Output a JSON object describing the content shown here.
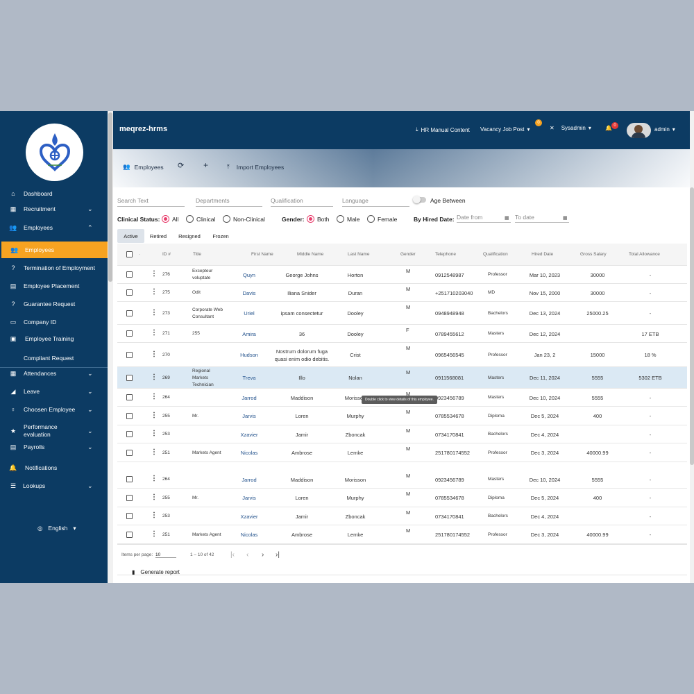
{
  "app": {
    "title": "meqrez-hrms"
  },
  "topbar": {
    "hr_manual": "HR Manual Content",
    "vacancy": "Vacancy Job Post",
    "vacancy_badge": "0",
    "sysadmin": "Sysadmin",
    "notif_badge": "0",
    "user": "admin"
  },
  "banner": {
    "employees": "Employees",
    "refresh": "⟳",
    "add": "+",
    "import": "Import Employees"
  },
  "sidebar": {
    "items": [
      {
        "label": "Dashboard",
        "icon": "⌂"
      },
      {
        "label": "Recruitment",
        "icon": "▦"
      },
      {
        "label": "Employees",
        "icon": "👥"
      },
      {
        "label": "Employees",
        "icon": "👥"
      },
      {
        "label": "Termination of Employment",
        "icon": "?"
      },
      {
        "label": "Employee Placement",
        "icon": "▤"
      },
      {
        "label": "Guarantee Request",
        "icon": "?"
      },
      {
        "label": "Company ID",
        "icon": "▭"
      },
      {
        "label": "Employee Training",
        "icon": "▣"
      },
      {
        "label": "Compliant Request",
        "icon": ""
      },
      {
        "label": "Attendances",
        "icon": "▦"
      },
      {
        "label": "Leave",
        "icon": "◢"
      },
      {
        "label": "Choosen Employee",
        "icon": "♀"
      },
      {
        "label": "Performance evaluation",
        "icon": "★"
      },
      {
        "label": "Payrolls",
        "icon": "▤"
      },
      {
        "label": "Notifications",
        "icon": "🔔"
      },
      {
        "label": "Lookups",
        "icon": "☰"
      }
    ],
    "language": "English",
    "language_caret": "▾"
  },
  "filters": {
    "search_text": "Search Text",
    "departments": "Departments",
    "qualification": "Qualification",
    "language": "Language",
    "age_between": "Age Between",
    "clinical_status_label": "Clinical Status:",
    "clinical_options": [
      "All",
      "Clinical",
      "Non-Clinical"
    ],
    "gender_label": "Gender:",
    "gender_options": [
      "Both",
      "Male",
      "Female"
    ],
    "hired_label": "By Hired Date:",
    "date_from": "Date from",
    "to_date": "To date"
  },
  "tabs": [
    "Active",
    "Retired",
    "Resigned",
    "Frozen"
  ],
  "table": {
    "headers": [
      "ID #",
      "Title",
      "First Name",
      "Middle Name",
      "Last Name",
      "Gender",
      "Telephone",
      "Qualification",
      "Hired Date",
      "Gross Salary",
      "Total Allowance"
    ],
    "sort_dot": "·",
    "rows": [
      {
        "id": "276",
        "title": "Excepteur voluptate",
        "first": "Quyn",
        "middle": "George Johns",
        "last": "Horton",
        "gender": "M",
        "tel": "0912548987",
        "qual": "Professor",
        "hired": "Mar 10, 2023",
        "salary": "30000",
        "allow": "-"
      },
      {
        "id": "275",
        "title": "Odit",
        "first": "Davis",
        "middle": "Iliana Snider",
        "last": "Duran",
        "gender": "M",
        "tel": "+251710203040",
        "qual": "MD",
        "hired": "Nov 15, 2000",
        "salary": "30000",
        "allow": "-"
      },
      {
        "id": "273",
        "title": "Corporate Web Consultant",
        "first": "Uriel",
        "middle": "ipsam consectetur",
        "last": "Dooley",
        "gender": "M",
        "tel": "0948948948",
        "qual": "Bachelors",
        "hired": "Dec 13, 2024",
        "salary": "25000.25",
        "allow": "-"
      },
      {
        "id": "271",
        "title": "255",
        "first": "Amira",
        "middle": "36",
        "last": "Dooley",
        "gender": "F",
        "tel": "0789455612",
        "qual": "Masters",
        "hired": "Dec 12, 2024",
        "salary": "",
        "allow": "17 ETB"
      },
      {
        "id": "270",
        "title": "",
        "first": "Hudson",
        "middle": "Nostrum dolorum fuga quasi enim odio debitis.",
        "last": "Crist",
        "gender": "M",
        "tel": "0965456545",
        "qual": "Professor",
        "hired": "Jan 23, 2",
        "salary": "15000",
        "allow": "18 %"
      },
      {
        "id": "269",
        "title": "Regional Markets Technician",
        "first": "Treva",
        "middle": "Illo",
        "last": "Nolan",
        "gender": "M",
        "tel": "0911568081",
        "qual": "Masters",
        "hired": "Dec 11, 2024",
        "salary": "5555",
        "allow": "5302 ETB"
      },
      {
        "id": "264",
        "title": "",
        "first": "Jarrod",
        "middle": "Maddison",
        "last": "Morisson",
        "gender": "M",
        "tel": "0923456789",
        "qual": "Masters",
        "hired": "Dec 10, 2024",
        "salary": "5555",
        "allow": "-"
      },
      {
        "id": "255",
        "title": "Mr.",
        "first": "Jarvis",
        "middle": "Loren",
        "last": "Murphy",
        "gender": "M",
        "tel": "0785534678",
        "qual": "Diploma",
        "hired": "Dec 5, 2024",
        "salary": "400",
        "allow": "-"
      },
      {
        "id": "253",
        "title": "",
        "first": "Xzavier",
        "middle": "Jamir",
        "last": "Zboncak",
        "gender": "M",
        "tel": "0734170841",
        "qual": "Bachelors",
        "hired": "Dec 4, 2024",
        "salary": "",
        "allow": "-"
      },
      {
        "id": "251",
        "title": "Markets Agent",
        "first": "Nicolas",
        "middle": "Ambrose",
        "last": "Lemke",
        "gender": "M",
        "tel": "251780174552",
        "qual": "Professor",
        "hired": "Dec 3, 2024",
        "salary": "40000.99",
        "allow": "-"
      },
      {
        "id": "264",
        "title": "",
        "first": "Jarrod",
        "middle": "Maddison",
        "last": "Morisson",
        "gender": "M",
        "tel": "0923456789",
        "qual": "Masters",
        "hired": "Dec 10, 2024",
        "salary": "5555",
        "allow": "-"
      },
      {
        "id": "255",
        "title": "Mr.",
        "first": "Jarvis",
        "middle": "Loren",
        "last": "Murphy",
        "gender": "M",
        "tel": "0785534678",
        "qual": "Diploma",
        "hired": "Dec 5, 2024",
        "salary": "400",
        "allow": "-"
      },
      {
        "id": "253",
        "title": "",
        "first": "Xzavier",
        "middle": "Jamir",
        "last": "Zboncak",
        "gender": "M",
        "tel": "0734170841",
        "qual": "Bachelors",
        "hired": "Dec 4, 2024",
        "salary": "",
        "allow": "-"
      },
      {
        "id": "251",
        "title": "Markets Agent",
        "first": "Nicolas",
        "middle": "Ambrose",
        "last": "Lemke",
        "gender": "M",
        "tel": "251780174552",
        "qual": "Professor",
        "hired": "Dec 3, 2024",
        "salary": "40000.99",
        "allow": "-"
      }
    ]
  },
  "tooltip": "Double click to view details of this employee.",
  "pagination": {
    "items_per_page_label": "Items per page:",
    "items_per_page": "10",
    "range": "1 – 10 of 42",
    "first": "|‹",
    "prev": "‹",
    "next": "›",
    "last": "›|"
  },
  "generate_report": "Generate report",
  "colors": {
    "sidebar": "#0c3b63",
    "accent": "#f7a321",
    "radio": "#e83e6c",
    "link": "#1f4f8a"
  }
}
